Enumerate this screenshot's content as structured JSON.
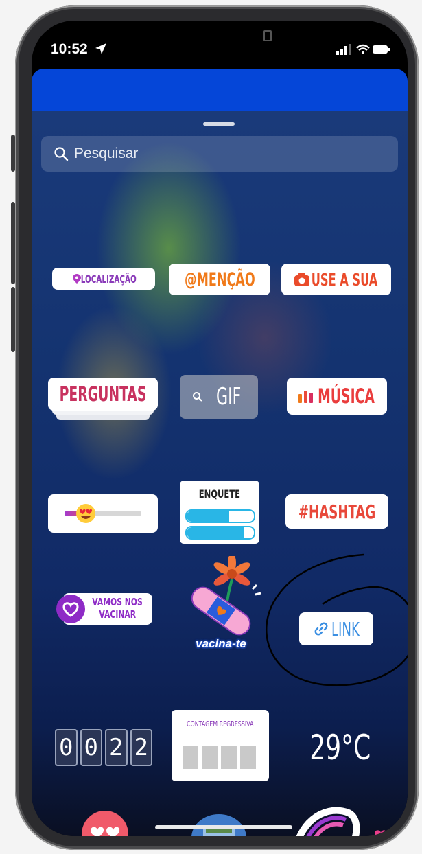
{
  "status_bar": {
    "time": "10:52"
  },
  "search": {
    "placeholder": "Pesquisar"
  },
  "stickers": {
    "location": "LOCALIZAÇÃO",
    "mention": "@MENÇÃO",
    "use_yours": "USE A SUA",
    "questions": "PERGUNTAS",
    "gif": "GIF",
    "music": "MÚSICA",
    "poll": "ENQUETE",
    "hashtag": "#HASHTAG",
    "vaccinate_line1": "VAMOS NOS",
    "vaccinate_line2": "VACINAR",
    "vacina_te": "vacina-te",
    "link": "LINK",
    "time_digits": [
      "0",
      "0",
      "2",
      "2"
    ],
    "countdown": "CONTAGEM REGRESSIVA",
    "temperature": "29°C"
  },
  "icons": [
    "location-arrow-icon",
    "signal-icon",
    "wifi-icon",
    "battery-icon",
    "search-icon",
    "pin-icon",
    "camera-icon",
    "music-bars-icon",
    "link-icon",
    "heart-eyes-emoji-icon"
  ],
  "colors": {
    "accent_blue": "#0546d8",
    "instagram_pink": "#c8325f",
    "orange": "#f07a1a",
    "purple": "#8a3ab9"
  }
}
